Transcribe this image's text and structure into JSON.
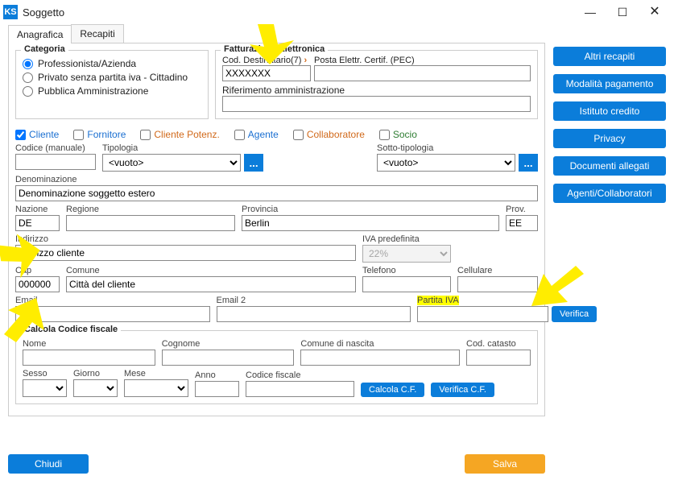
{
  "window": {
    "title": "Soggetto"
  },
  "tabs": {
    "anagrafica": "Anagrafica",
    "recapiti": "Recapiti"
  },
  "categoria": {
    "legend": "Categoria",
    "opt_prof": "Professionista/Azienda",
    "opt_priv": "Privato senza partita iva - Cittadino",
    "opt_pa": "Pubblica Amministrazione"
  },
  "fatt": {
    "legend": "Fatturazione Elettronica",
    "cod_dest_label": "Cod. Destinatario(7)",
    "pec_label": "Posta Elettr. Certif. (PEC)",
    "cod_dest_value": "XXXXXXX",
    "pec_value": "",
    "rif_amm_label": "Riferimento amministrazione",
    "rif_amm_value": ""
  },
  "checks": {
    "cliente": "Cliente",
    "fornitore": "Fornitore",
    "cliente_pot": "Cliente Potenz.",
    "agente": "Agente",
    "collaboratore": "Collaboratore",
    "socio": "Socio"
  },
  "fields": {
    "codice_label": "Codice (manuale)",
    "codice_value": "",
    "tipologia_label": "Tipologia",
    "tipologia_value": "<vuoto>",
    "sotto_tipologia_label": "Sotto-tipologia",
    "sotto_tipologia_value": "<vuoto>",
    "denominazione_label": "Denominazione",
    "denominazione_value": "Denominazione soggetto estero",
    "nazione_label": "Nazione",
    "nazione_value": "DE",
    "regione_label": "Regione",
    "regione_value": "",
    "provincia_label": "Provincia",
    "provincia_value": "Berlin",
    "prov_label": "Prov.",
    "prov_value": "EE",
    "indirizzo_label": "Indirizzo",
    "indirizzo_value": "indirizzo cliente",
    "iva_pred_label": "IVA predefinita",
    "iva_pred_value": "22%",
    "cap_label": "Cap",
    "cap_value": "000000",
    "comune_label": "Comune",
    "comune_value": "Città del cliente",
    "telefono_label": "Telefono",
    "telefono_value": "",
    "cellulare_label": "Cellulare",
    "cellulare_value": "",
    "email_label": "Email",
    "email_value": "",
    "email2_label": "Email 2",
    "email2_value": "",
    "piva_label": "Partita IVA",
    "piva_value": "",
    "verifica_btn": "Verifica"
  },
  "cf": {
    "legend": "Calcola Codice fiscale",
    "nome_label": "Nome",
    "cognome_label": "Cognome",
    "comune_nascita_label": "Comune di nascita",
    "cod_catasto_label": "Cod. catasto",
    "sesso_label": "Sesso",
    "giorno_label": "Giorno",
    "mese_label": "Mese",
    "anno_label": "Anno",
    "cf_label": "Codice fiscale",
    "calcola_btn": "Calcola C.F.",
    "verifica_btn": "Verifica C.F."
  },
  "sidebar": {
    "altri_recapiti": "Altri recapiti",
    "modalita_pagamento": "Modalità pagamento",
    "istituto_credito": "Istituto credito",
    "privacy": "Privacy",
    "documenti_allegati": "Documenti allegati",
    "agenti_collab": "Agenti/Collaboratori"
  },
  "footer": {
    "chiudi": "Chiudi",
    "salva": "Salva"
  },
  "ellipsis": "..."
}
